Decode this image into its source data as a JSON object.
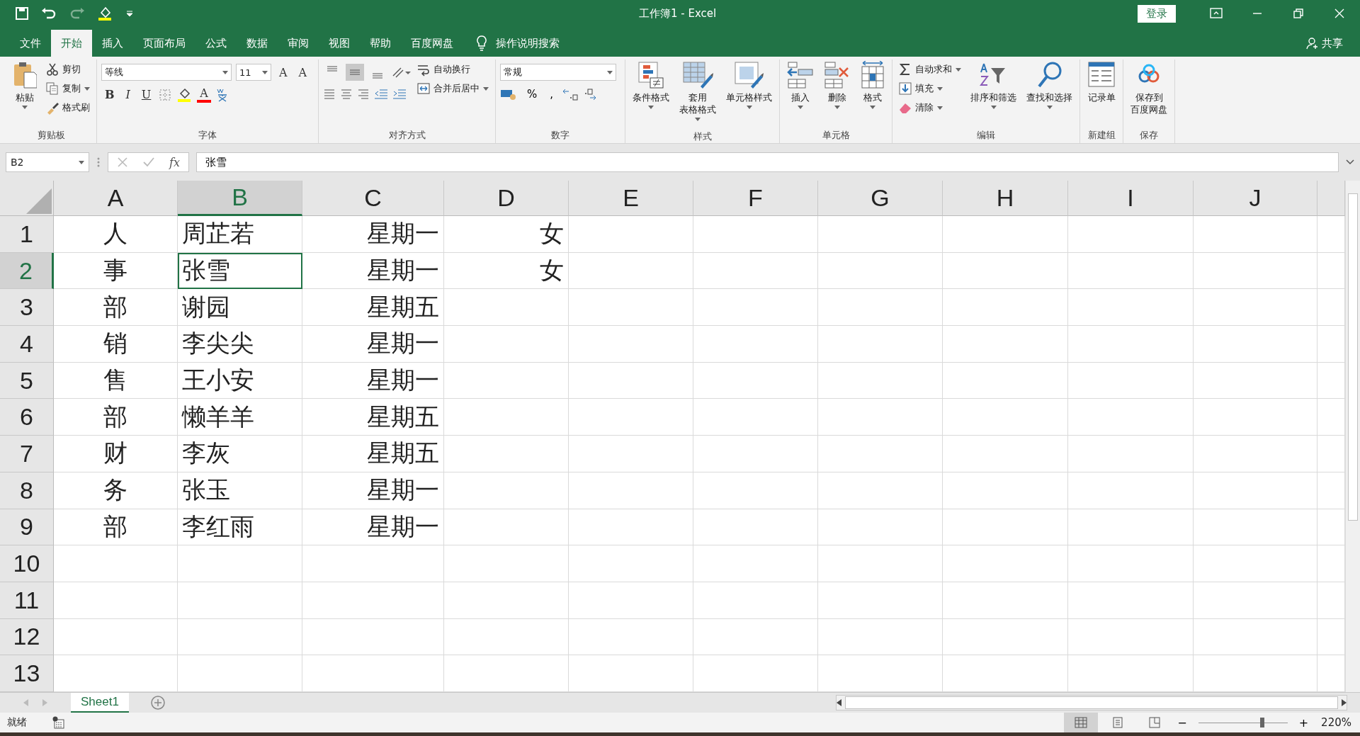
{
  "window": {
    "title": "工作簿1  -  Excel",
    "login": "登录"
  },
  "menu": [
    {
      "label": "文件",
      "selected": false
    },
    {
      "label": "开始",
      "selected": true
    },
    {
      "label": "插入",
      "selected": false
    },
    {
      "label": "页面布局",
      "selected": false
    },
    {
      "label": "公式",
      "selected": false
    },
    {
      "label": "数据",
      "selected": false
    },
    {
      "label": "审阅",
      "selected": false
    },
    {
      "label": "视图",
      "selected": false
    },
    {
      "label": "帮助",
      "selected": false
    },
    {
      "label": "百度网盘",
      "selected": false
    }
  ],
  "search": {
    "placeholder": "操作说明搜索"
  },
  "share": "共享",
  "ribbon": [
    {
      "label": "剪贴板",
      "items": [
        {
          "kind": "large",
          "label": "粘贴",
          "dropdown": true
        },
        {
          "kind": "stack",
          "items": [
            {
              "label": "剪切",
              "dropdown": false
            },
            {
              "label": "复制",
              "dropdown": true
            },
            {
              "label": "格式刷",
              "dropdown": false
            }
          ]
        }
      ]
    },
    {
      "label": "字体",
      "items": [
        {
          "kind": "font",
          "font": "等线",
          "size": "11",
          "grow": "A",
          "shrink": "A",
          "styles": [
            "B",
            "I",
            "U"
          ],
          "color_letter": "A"
        }
      ]
    },
    {
      "label": "对齐方式",
      "items": [
        {
          "kind": "align",
          "valign": [
            {
              "selected": false
            },
            {
              "selected": true
            },
            {
              "selected": false
            }
          ]
        },
        {
          "kind": "stack",
          "items": [
            {
              "label": "自动换行",
              "dropdown": false
            },
            {
              "label": "合并后居中",
              "dropdown": true
            }
          ]
        }
      ]
    },
    {
      "label": "数字",
      "items": [
        {
          "kind": "number",
          "format": "常规",
          "symbols": [
            "%",
            ","
          ]
        }
      ]
    },
    {
      "label": "样式",
      "items": [
        {
          "kind": "large",
          "label": "条件格式",
          "dropdown": true
        },
        {
          "kind": "large",
          "lines": [
            "套用",
            "表格格式"
          ],
          "dropdown": true
        },
        {
          "kind": "large",
          "label": "单元格样式",
          "dropdown": true
        }
      ]
    },
    {
      "label": "单元格",
      "items": [
        {
          "kind": "large",
          "label": "插入",
          "dropdown": true
        },
        {
          "kind": "large",
          "label": "删除",
          "dropdown": true
        },
        {
          "kind": "large",
          "label": "格式",
          "dropdown": true
        }
      ]
    },
    {
      "label": "编辑",
      "items": [
        {
          "kind": "stack",
          "items": [
            {
              "label": "自动求和",
              "dropdown": true
            },
            {
              "label": "填充",
              "dropdown": true
            },
            {
              "label": "清除",
              "dropdown": true
            }
          ]
        },
        {
          "kind": "large",
          "label": "排序和筛选",
          "dropdown": true
        },
        {
          "kind": "large",
          "label": "查找和选择",
          "dropdown": true
        }
      ]
    },
    {
      "label": "新建组",
      "items": [
        {
          "kind": "large",
          "label": "记录单",
          "dropdown": false
        }
      ]
    },
    {
      "label": "保存",
      "items": [
        {
          "kind": "large",
          "lines": [
            "保存到",
            "百度网盘"
          ],
          "dropdown": false
        }
      ]
    }
  ],
  "formula_bar": {
    "name_box": "B2",
    "fx": "fx",
    "value": "张雪"
  },
  "columns": [
    {
      "label": "A",
      "selected": false
    },
    {
      "label": "B",
      "selected": true
    },
    {
      "label": "C",
      "selected": false
    },
    {
      "label": "D",
      "selected": false
    },
    {
      "label": "E",
      "selected": false
    },
    {
      "label": "F",
      "selected": false
    },
    {
      "label": "G",
      "selected": false
    },
    {
      "label": "H",
      "selected": false
    },
    {
      "label": "I",
      "selected": false
    },
    {
      "label": "J",
      "selected": false
    }
  ],
  "rows": [
    {
      "header": "1",
      "selected": false,
      "cells": [
        "人",
        "周芷若",
        "星期一",
        "女"
      ]
    },
    {
      "header": "2",
      "selected": true,
      "cells": [
        "事",
        "张雪",
        "星期一",
        "女"
      ]
    },
    {
      "header": "3",
      "selected": false,
      "cells": [
        "部",
        "谢园",
        "星期五"
      ]
    },
    {
      "header": "4",
      "selected": false,
      "cells": [
        "销",
        "李尖尖",
        "星期一"
      ]
    },
    {
      "header": "5",
      "selected": false,
      "cells": [
        "售",
        "王小安",
        "星期一"
      ]
    },
    {
      "header": "6",
      "selected": false,
      "cells": [
        "部",
        "懒羊羊",
        "星期五"
      ]
    },
    {
      "header": "7",
      "selected": false,
      "cells": [
        "财",
        "李灰",
        "星期五"
      ]
    },
    {
      "header": "8",
      "selected": false,
      "cells": [
        "务",
        "张玉",
        "星期一"
      ]
    },
    {
      "header": "9",
      "selected": false,
      "cells": [
        "部",
        "李红雨",
        "星期一"
      ]
    },
    {
      "header": "10",
      "selected": false,
      "cells": []
    },
    {
      "header": "11",
      "selected": false,
      "cells": []
    },
    {
      "header": "12",
      "selected": false,
      "cells": []
    },
    {
      "header": "13",
      "selected": false,
      "cells": []
    }
  ],
  "sheets": [
    {
      "label": "Sheet1",
      "selected": true
    }
  ],
  "status_bar": {
    "text": "就绪",
    "views": [
      {
        "selected": true
      },
      {
        "selected": false
      },
      {
        "selected": false
      }
    ],
    "zoom_out": "−",
    "zoom_in": "+",
    "zoom": {
      "level": 0.72
    },
    "zoom_text": "220%"
  }
}
